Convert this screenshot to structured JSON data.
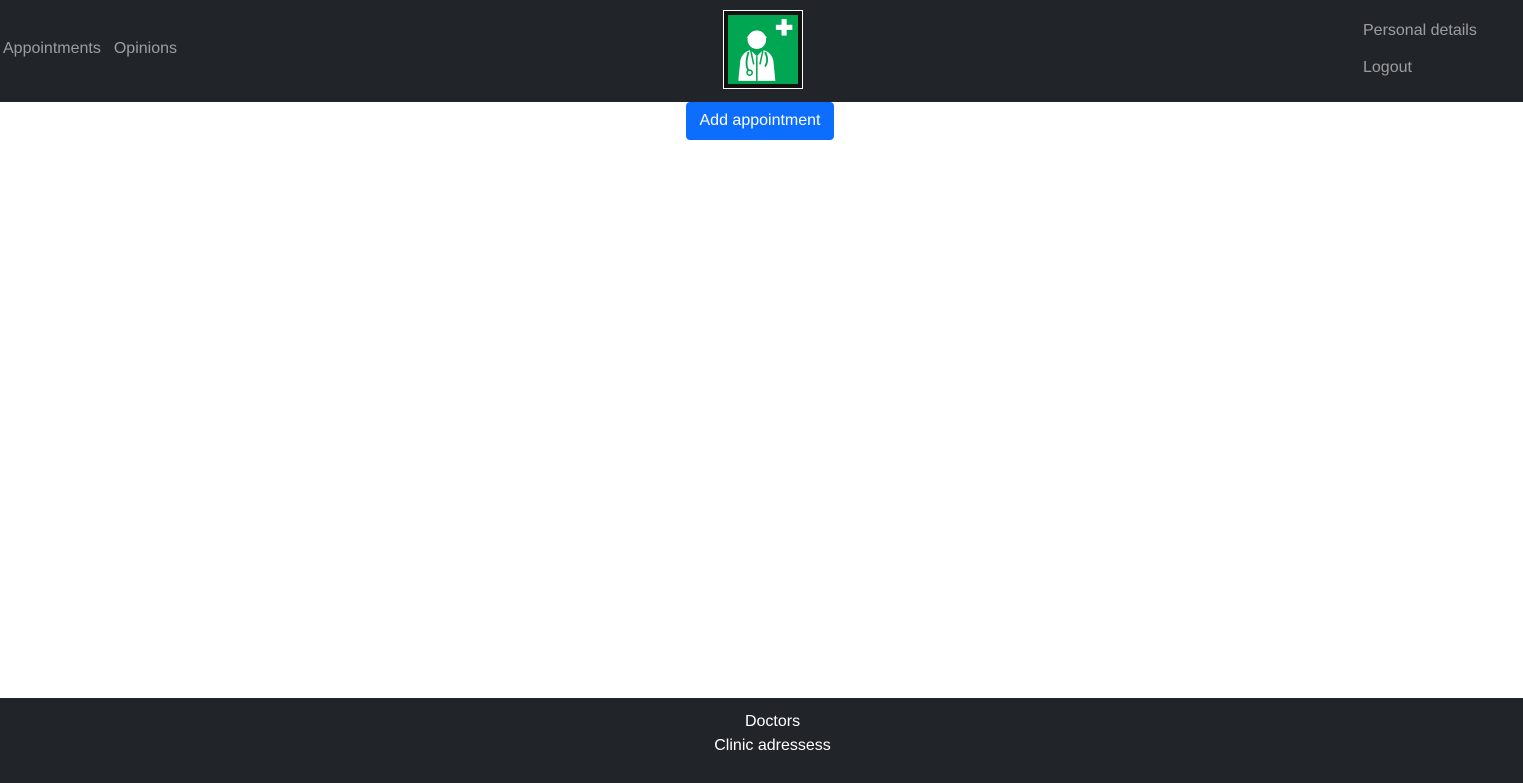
{
  "header": {
    "left_links": [
      {
        "label": "Appointments"
      },
      {
        "label": "Opinions"
      }
    ],
    "logo": {
      "icon": "doctor-first-aid-icon",
      "bg_color": "#00a651"
    },
    "right_links": [
      {
        "label": "Personal details"
      },
      {
        "label": "Logout"
      }
    ],
    "bg_color": "#212529"
  },
  "main": {
    "add_button_label": "Add appointment",
    "accent_color": "#0d6efd"
  },
  "footer": {
    "links": [
      {
        "label": "Doctors"
      },
      {
        "label": "Clinic adressess"
      }
    ]
  }
}
